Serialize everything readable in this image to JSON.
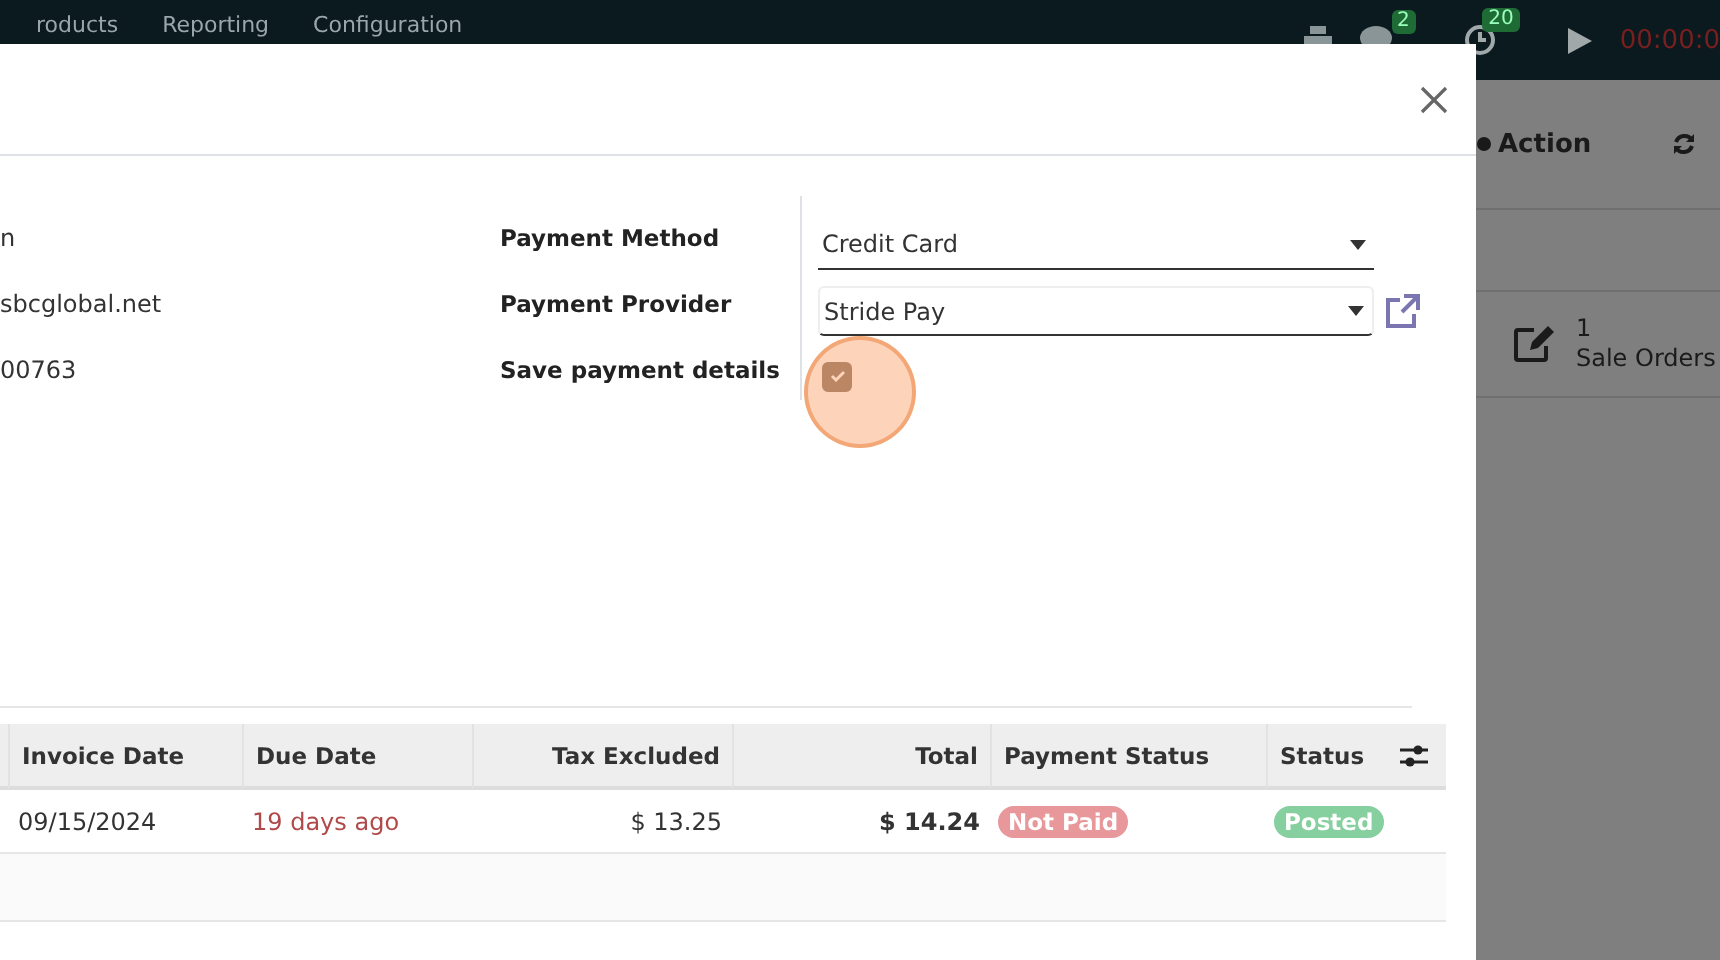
{
  "navbar": {
    "menu": [
      "roducts",
      "Reporting",
      "Configuration"
    ],
    "indicators": [
      {
        "kind": "chat",
        "badge": "2"
      },
      {
        "kind": "clock",
        "badge": "20"
      }
    ],
    "timer": "00:00:0"
  },
  "control_panel": {
    "action": "Action"
  },
  "smart_button": {
    "count": "1",
    "label": "Sale Orders"
  },
  "dialog": {
    "left_values": [
      "n",
      "sbcglobal.net",
      "00763"
    ],
    "fields": [
      {
        "kind": "select",
        "label": "Payment Method",
        "value": "Credit Card"
      },
      {
        "kind": "select-link",
        "label": "Payment Provider",
        "value": "Stride Pay"
      },
      {
        "kind": "checkbox",
        "label": "Save payment details",
        "checked": true
      }
    ],
    "table": {
      "columns": [
        "Invoice Date",
        "Due Date",
        "Tax Excluded",
        "Total",
        "Payment Status",
        "Status"
      ],
      "rows": [
        [
          {
            "kind": "text",
            "text": "09/15/2024"
          },
          {
            "kind": "overdue",
            "text": "19 days ago"
          },
          {
            "kind": "amount",
            "text": "$ 13.25"
          },
          {
            "kind": "total",
            "text": "$ 14.24"
          },
          {
            "kind": "badge",
            "text": "Not Paid",
            "color": "#e8979b"
          },
          {
            "kind": "badge",
            "text": "Posted",
            "color": "#86cf9e"
          }
        ]
      ]
    }
  }
}
